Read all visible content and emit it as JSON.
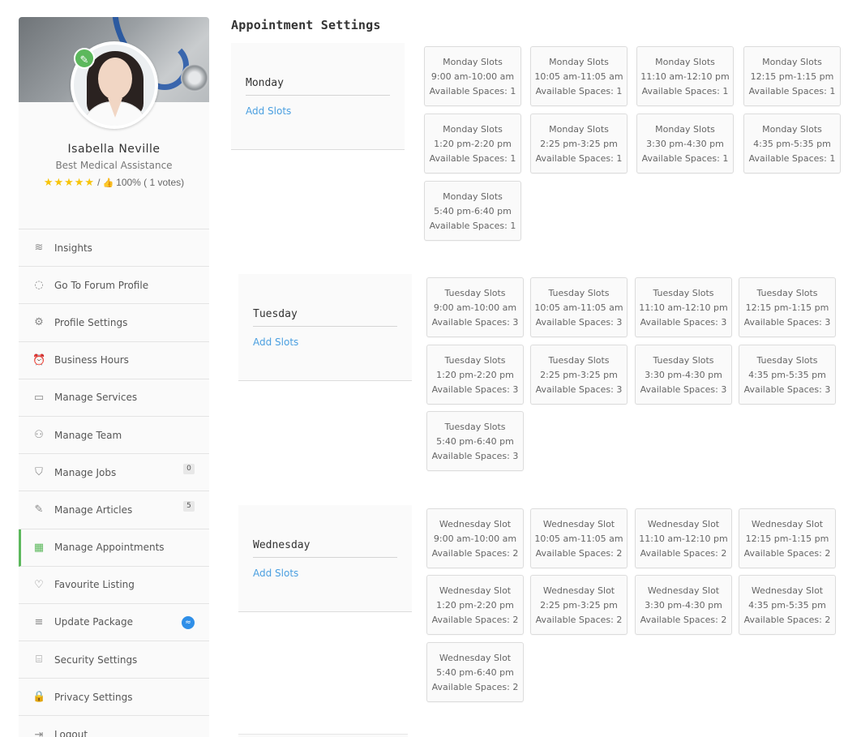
{
  "page_title": "Appointment Settings",
  "profile": {
    "name": "Isabella Neville",
    "title": "Best Medical Assistance",
    "stars": "★★★★★",
    "rating_sep": "/",
    "rating_text": "100% ( 1 votes)"
  },
  "sidebar": {
    "items": [
      {
        "label": "Insights",
        "icon": "layers-icon",
        "glyph": "≋"
      },
      {
        "label": "Go To Forum Profile",
        "icon": "chat-icon",
        "glyph": "◌"
      },
      {
        "label": "Profile Settings",
        "icon": "gear-icon",
        "glyph": "⚙"
      },
      {
        "label": "Business Hours",
        "icon": "alarm-clock-icon",
        "glyph": "⏰"
      },
      {
        "label": "Manage Services",
        "icon": "briefcase-icon",
        "glyph": "▭"
      },
      {
        "label": "Manage Team",
        "icon": "team-icon",
        "glyph": "⚇"
      },
      {
        "label": "Manage Jobs",
        "icon": "graduation-cap-icon",
        "glyph": "⛉",
        "badge": "0"
      },
      {
        "label": "Manage Articles",
        "icon": "pencil-icon",
        "glyph": "✎",
        "badge": "5"
      },
      {
        "label": "Manage Appointments",
        "icon": "calendar-icon",
        "glyph": "▦",
        "active": true
      },
      {
        "label": "Favourite Listing",
        "icon": "heart-icon",
        "glyph": "♡"
      },
      {
        "label": "Update Package",
        "icon": "database-icon",
        "glyph": "≡",
        "pkg_badge": "≈"
      },
      {
        "label": "Security Settings",
        "icon": "shop-icon",
        "glyph": "⌸"
      },
      {
        "label": "Privacy Settings",
        "icon": "lock-icon",
        "glyph": "🔒"
      },
      {
        "label": "Logout",
        "icon": "logout-icon",
        "glyph": "⇥"
      }
    ]
  },
  "days": [
    {
      "name": "Monday",
      "add_slots_label": "Add Slots",
      "slots": [
        {
          "title": "Monday Slots",
          "time": "9:00 am-10:00 am",
          "spaces": "Available Spaces: 1"
        },
        {
          "title": "Monday Slots",
          "time": "10:05 am-11:05 am",
          "spaces": "Available Spaces: 1"
        },
        {
          "title": "Monday Slots",
          "time": "11:10 am-12:10 pm",
          "spaces": "Available Spaces: 1"
        },
        {
          "title": "Monday Slots",
          "time": "12:15 pm-1:15 pm",
          "spaces": "Available Spaces: 1"
        },
        {
          "title": "Monday Slots",
          "time": "1:20 pm-2:20 pm",
          "spaces": "Available Spaces: 1"
        },
        {
          "title": "Monday Slots",
          "time": "2:25 pm-3:25 pm",
          "spaces": "Available Spaces: 1"
        },
        {
          "title": "Monday Slots",
          "time": "3:30 pm-4:30 pm",
          "spaces": "Available Spaces: 1"
        },
        {
          "title": "Monday Slots",
          "time": "4:35 pm-5:35 pm",
          "spaces": "Available Spaces: 1"
        },
        {
          "title": "Monday Slots",
          "time": "5:40 pm-6:40 pm",
          "spaces": "Available Spaces: 1"
        }
      ]
    },
    {
      "name": "Tuesday",
      "add_slots_label": "Add Slots",
      "slots": [
        {
          "title": "Tuesday Slots",
          "time": "9:00 am-10:00 am",
          "spaces": "Available Spaces: 3"
        },
        {
          "title": "Tuesday Slots",
          "time": "10:05 am-11:05 am",
          "spaces": "Available Spaces: 3"
        },
        {
          "title": "Tuesday Slots",
          "time": "11:10 am-12:10 pm",
          "spaces": "Available Spaces: 3"
        },
        {
          "title": "Tuesday Slots",
          "time": "12:15 pm-1:15 pm",
          "spaces": "Available Spaces: 3"
        },
        {
          "title": "Tuesday Slots",
          "time": "1:20 pm-2:20 pm",
          "spaces": "Available Spaces: 3"
        },
        {
          "title": "Tuesday Slots",
          "time": "2:25 pm-3:25 pm",
          "spaces": "Available Spaces: 3"
        },
        {
          "title": "Tuesday Slots",
          "time": "3:30 pm-4:30 pm",
          "spaces": "Available Spaces: 3"
        },
        {
          "title": "Tuesday Slots",
          "time": "4:35 pm-5:35 pm",
          "spaces": "Available Spaces: 3"
        },
        {
          "title": "Tuesday Slots",
          "time": "5:40 pm-6:40 pm",
          "spaces": "Available Spaces: 3"
        }
      ]
    },
    {
      "name": "Wednesday",
      "add_slots_label": "Add Slots",
      "slots": [
        {
          "title": "Wednesday Slot",
          "time": "9:00 am-10:00 am",
          "spaces": "Available Spaces: 2"
        },
        {
          "title": "Wednesday Slot",
          "time": "10:05 am-11:05 am",
          "spaces": "Available Spaces: 2"
        },
        {
          "title": "Wednesday Slot",
          "time": "11:10 am-12:10 pm",
          "spaces": "Available Spaces: 2"
        },
        {
          "title": "Wednesday Slot",
          "time": "12:15 pm-1:15 pm",
          "spaces": "Available Spaces: 2"
        },
        {
          "title": "Wednesday Slot",
          "time": "1:20 pm-2:20 pm",
          "spaces": "Available Spaces: 2"
        },
        {
          "title": "Wednesday Slot",
          "time": "2:25 pm-3:25 pm",
          "spaces": "Available Spaces: 2"
        },
        {
          "title": "Wednesday Slot",
          "time": "3:30 pm-4:30 pm",
          "spaces": "Available Spaces: 2"
        },
        {
          "title": "Wednesday Slot",
          "time": "4:35 pm-5:35 pm",
          "spaces": "Available Spaces: 2"
        },
        {
          "title": "Wednesday Slot",
          "time": "5:40 pm-6:40 pm",
          "spaces": "Available Spaces: 2"
        }
      ]
    }
  ],
  "colors": {
    "accent_green": "#5cb85c",
    "link_blue": "#4a9fe0",
    "star_yellow": "#f7c40b",
    "badge_blue": "#2f8fe8"
  }
}
